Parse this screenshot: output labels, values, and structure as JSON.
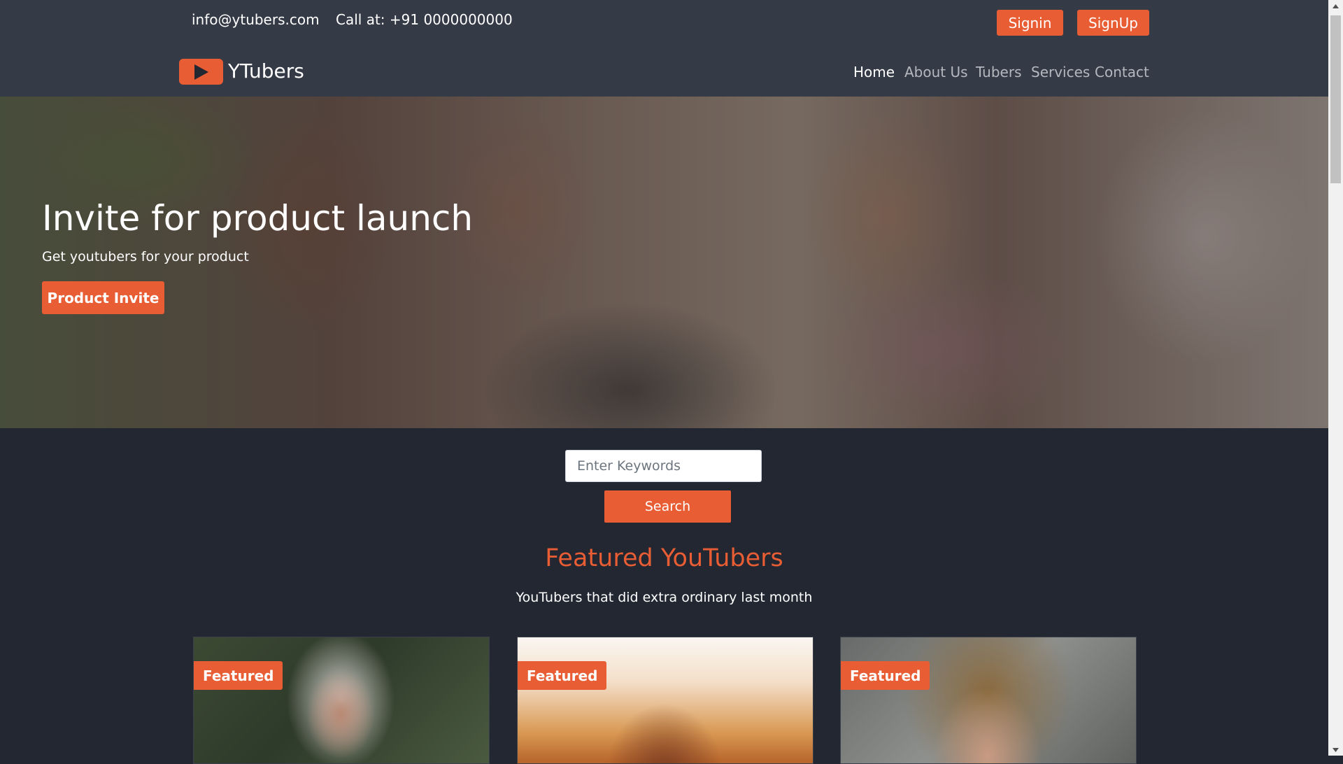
{
  "topbar": {
    "email": "info@ytubers.com",
    "phone": "Call at: +91 0000000000",
    "signin_label": "Signin",
    "signup_label": "SignUp"
  },
  "navbar": {
    "brand": "YTubers",
    "logo_icon": "play-icon",
    "links": [
      {
        "label": "Home",
        "active": true
      },
      {
        "label": "About Us"
      },
      {
        "label": "Tubers"
      },
      {
        "label": "Services"
      },
      {
        "label": "Contact"
      }
    ]
  },
  "hero": {
    "title": "Invite for product launch",
    "subtitle": "Get youtubers for your product",
    "button_label": "Product Invite"
  },
  "search": {
    "placeholder": "Enter Keywords",
    "button_label": "Search"
  },
  "featured": {
    "title": "Featured YouTubers",
    "subtitle": "YouTubers that did extra ordinary last month",
    "cards": [
      {
        "badge": "Featured"
      },
      {
        "badge": "Featured"
      },
      {
        "badge": "Featured"
      }
    ]
  },
  "colors": {
    "accent": "#e85d33",
    "page_bg": "#222732",
    "bar_bg": "#343a46"
  }
}
